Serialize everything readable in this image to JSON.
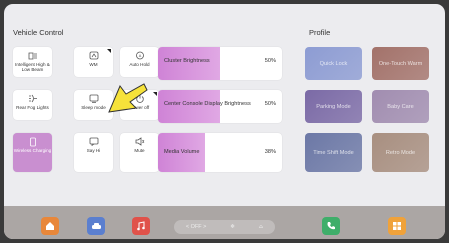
{
  "vehicle_control": {
    "title": "Vehicle Control",
    "tiles": [
      {
        "label": "Intelligent High & Low Beam",
        "icon": "headlight-icon"
      },
      {
        "label": "WM",
        "icon": "window-mode-icon"
      },
      {
        "label": "Auto Hold",
        "icon": "auto-hold-icon"
      },
      {
        "label": "Rear Fog Lights",
        "icon": "fog-light-icon"
      },
      {
        "label": "Sleep mode",
        "icon": "sleep-mode-icon"
      },
      {
        "label": "Power off",
        "icon": "power-off-icon"
      },
      {
        "label": "Wireless Charging",
        "icon": "wireless-charging-icon",
        "active": true
      },
      {
        "label": "Say Hi",
        "icon": "say-hi-icon"
      },
      {
        "label": "Mute",
        "icon": "mute-icon"
      }
    ],
    "sliders": [
      {
        "label": "Cluster Brightness",
        "value": "50%",
        "level": 0.5
      },
      {
        "label": "Center Console Display Brightness",
        "value": "50%",
        "level": 0.5
      },
      {
        "label": "Media Volume",
        "value": "38%",
        "level": 0.38
      }
    ]
  },
  "profile": {
    "title": "Profile",
    "cards": [
      {
        "label": "Quick Lock",
        "color": "#8d9cd3"
      },
      {
        "label": "One-Touch Warm",
        "color": "#a3726a"
      },
      {
        "label": "Parking Mode",
        "color": "#7b6aa6"
      },
      {
        "label": "Baby Care",
        "color": "#a18db0"
      },
      {
        "label": "Time Shift Mode",
        "color": "#6c78a6"
      },
      {
        "label": "Retro Mode",
        "color": "#a88f80"
      }
    ]
  },
  "dock": {
    "apps": [
      {
        "name": "home-icon",
        "color": "#e8873a"
      },
      {
        "name": "car-icon",
        "color": "#5b7fcf"
      },
      {
        "name": "music-icon",
        "color": "#e0524a"
      },
      {
        "name": "phone-icon",
        "color": "#3fae6a"
      },
      {
        "name": "apps-grid-icon",
        "color": "#f0a23a"
      }
    ],
    "climate": {
      "off": "< OFF >",
      "fan": "❄",
      "seat": "⌓"
    }
  }
}
